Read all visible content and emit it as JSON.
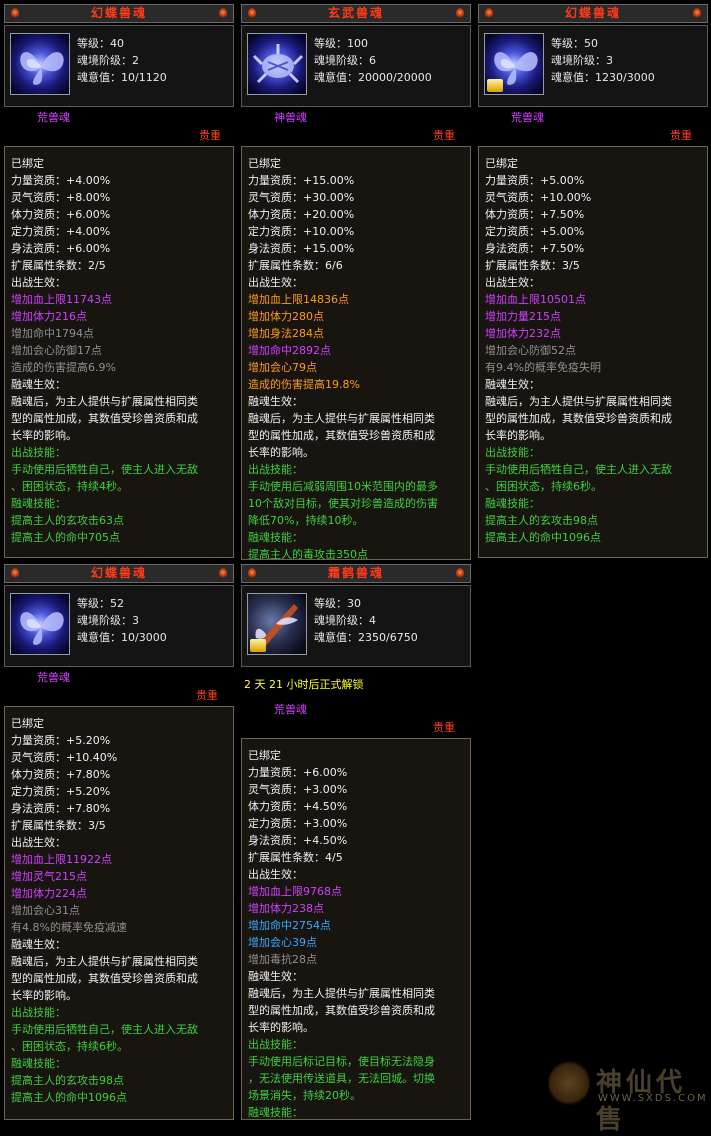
{
  "cards": [
    {
      "title": "幻蝶兽魂",
      "stats": [
        "等级：40",
        "魂境阶级：2",
        "魂意值：10/1120"
      ],
      "type": "荒兽魂",
      "rarity": "贵重",
      "lines": [
        {
          "t": "已绑定",
          "c": "w"
        },
        {
          "t": "力量资质：+4.00%",
          "c": "w"
        },
        {
          "t": "灵气资质：+8.00%",
          "c": "w"
        },
        {
          "t": "体力资质：+6.00%",
          "c": "w"
        },
        {
          "t": "定力资质：+4.00%",
          "c": "w"
        },
        {
          "t": "身法资质：+6.00%",
          "c": "w"
        },
        {
          "t": "扩展属性条数：2/5",
          "c": "w"
        },
        {
          "t": "出战生效：",
          "c": "w"
        },
        {
          "t": "增加血上限11743点",
          "c": "p"
        },
        {
          "t": "增加体力216点",
          "c": "p"
        },
        {
          "t": "增加命中1794点",
          "c": "g"
        },
        {
          "t": "增加会心防御17点",
          "c": "g"
        },
        {
          "t": "造成的伤害提高6.9%",
          "c": "g"
        },
        {
          "t": "融魂生效：",
          "c": "w"
        },
        {
          "t": "融魂后，为主人提供与扩展属性相同类",
          "c": "w"
        },
        {
          "t": "型的属性加成，其数值受珍兽资质和成",
          "c": "w"
        },
        {
          "t": "长率的影响。",
          "c": "w"
        },
        {
          "t": "出战技能：",
          "c": "gr"
        },
        {
          "t": "手动使用后牺牲自己，使主人进入无敌",
          "c": "gr"
        },
        {
          "t": "、困困状态，持续4秒。",
          "c": "gr"
        },
        {
          "t": "融魂技能：",
          "c": "gr"
        },
        {
          "t": "提高主人的玄攻击63点",
          "c": "gr"
        },
        {
          "t": "提高主人的命中705点",
          "c": "gr"
        }
      ]
    },
    {
      "title": "玄武兽魂",
      "stats": [
        "等级：100",
        "魂境阶级：6",
        "魂意值：20000/20000"
      ],
      "type": "神兽魂",
      "rarity": "贵重",
      "lines": [
        {
          "t": "已绑定",
          "c": "w"
        },
        {
          "t": "力量资质：+15.00%",
          "c": "w"
        },
        {
          "t": "灵气资质：+30.00%",
          "c": "w"
        },
        {
          "t": "体力资质：+20.00%",
          "c": "w"
        },
        {
          "t": "定力资质：+10.00%",
          "c": "w"
        },
        {
          "t": "身法资质：+15.00%",
          "c": "w"
        },
        {
          "t": "扩展属性条数：6/6",
          "c": "w"
        },
        {
          "t": "出战生效：",
          "c": "w"
        },
        {
          "t": "增加血上限14836点",
          "c": "o"
        },
        {
          "t": "增加体力280点",
          "c": "o"
        },
        {
          "t": "增加身法284点",
          "c": "o"
        },
        {
          "t": "增加命中2892点",
          "c": "p"
        },
        {
          "t": "增加会心79点",
          "c": "o"
        },
        {
          "t": "造成的伤害提高19.8%",
          "c": "o"
        },
        {
          "t": "融魂生效：",
          "c": "w"
        },
        {
          "t": "融魂后，为主人提供与扩展属性相同类",
          "c": "w"
        },
        {
          "t": "型的属性加成，其数值受珍兽资质和成",
          "c": "w"
        },
        {
          "t": "长率的影响。",
          "c": "w"
        },
        {
          "t": "出战技能：",
          "c": "gr"
        },
        {
          "t": "手动使用后减弱周围10米范围内的最多",
          "c": "gr"
        },
        {
          "t": "10个敌对目标，使其对珍兽造成的伤害",
          "c": "gr"
        },
        {
          "t": "降低70%，持续10秒。",
          "c": "gr"
        },
        {
          "t": "融魂技能：",
          "c": "gr"
        },
        {
          "t": "提高主人的毒攻击350点",
          "c": "gr"
        }
      ]
    },
    {
      "title": "幻蝶兽魂",
      "stats": [
        "等级：50",
        "魂境阶级：3",
        "魂意值：1230/3000"
      ],
      "type": "荒兽魂",
      "rarity": "贵重",
      "lines": [
        {
          "t": "已绑定",
          "c": "w"
        },
        {
          "t": "力量资质：+5.00%",
          "c": "w"
        },
        {
          "t": "灵气资质：+10.00%",
          "c": "w"
        },
        {
          "t": "体力资质：+7.50%",
          "c": "w"
        },
        {
          "t": "定力资质：+5.00%",
          "c": "w"
        },
        {
          "t": "身法资质：+7.50%",
          "c": "w"
        },
        {
          "t": "扩展属性条数：3/5",
          "c": "w"
        },
        {
          "t": "出战生效：",
          "c": "w"
        },
        {
          "t": "增加血上限10501点",
          "c": "p"
        },
        {
          "t": "增加力量215点",
          "c": "p"
        },
        {
          "t": "增加体力232点",
          "c": "p"
        },
        {
          "t": "增加会心防御52点",
          "c": "g"
        },
        {
          "t": "有9.4%的概率免疫失明",
          "c": "g"
        },
        {
          "t": "融魂生效：",
          "c": "w"
        },
        {
          "t": "融魂后，为主人提供与扩展属性相同类",
          "c": "w"
        },
        {
          "t": "型的属性加成，其数值受珍兽资质和成",
          "c": "w"
        },
        {
          "t": "长率的影响。",
          "c": "w"
        },
        {
          "t": "出战技能：",
          "c": "gr"
        },
        {
          "t": "手动使用后牺牲自己，使主人进入无敌",
          "c": "gr"
        },
        {
          "t": "、困困状态，持续6秒。",
          "c": "gr"
        },
        {
          "t": "融魂技能：",
          "c": "gr"
        },
        {
          "t": "提高主人的玄攻击98点",
          "c": "gr"
        },
        {
          "t": "提高主人的命中1096点",
          "c": "gr"
        }
      ]
    },
    {
      "title": "幻蝶兽魂",
      "stats": [
        "等级：52",
        "魂境阶级：3",
        "魂意值：10/3000"
      ],
      "type": "荒兽魂",
      "rarity": "贵重",
      "lines": [
        {
          "t": "已绑定",
          "c": "w"
        },
        {
          "t": "力量资质：+5.20%",
          "c": "w"
        },
        {
          "t": "灵气资质：+10.40%",
          "c": "w"
        },
        {
          "t": "体力资质：+7.80%",
          "c": "w"
        },
        {
          "t": "定力资质：+5.20%",
          "c": "w"
        },
        {
          "t": "身法资质：+7.80%",
          "c": "w"
        },
        {
          "t": "扩展属性条数：3/5",
          "c": "w"
        },
        {
          "t": "出战生效：",
          "c": "w"
        },
        {
          "t": "增加血上限11922点",
          "c": "p"
        },
        {
          "t": "增加灵气215点",
          "c": "p"
        },
        {
          "t": "增加体力224点",
          "c": "p"
        },
        {
          "t": "增加会心31点",
          "c": "g"
        },
        {
          "t": "有4.8%的概率免疫减速",
          "c": "g"
        },
        {
          "t": "融魂生效：",
          "c": "w"
        },
        {
          "t": "融魂后，为主人提供与扩展属性相同类",
          "c": "w"
        },
        {
          "t": "型的属性加成，其数值受珍兽资质和成",
          "c": "w"
        },
        {
          "t": "长率的影响。",
          "c": "w"
        },
        {
          "t": "出战技能：",
          "c": "gr"
        },
        {
          "t": "手动使用后牺牲自己，使主人进入无敌",
          "c": "gr"
        },
        {
          "t": "、困困状态，持续6秒。",
          "c": "gr"
        },
        {
          "t": "融魂技能：",
          "c": "gr"
        },
        {
          "t": "提高主人的玄攻击98点",
          "c": "gr"
        },
        {
          "t": "提高主人的命中1096点",
          "c": "gr"
        }
      ]
    },
    {
      "title": "霜鹤兽魂",
      "stats": [
        "等级：30",
        "魂境阶级：4",
        "魂意值：2350/6750"
      ],
      "unlock": "2 天 21 小时后正式解锁",
      "type": "荒兽魂",
      "rarity": "贵重",
      "lines": [
        {
          "t": "已绑定",
          "c": "w"
        },
        {
          "t": "力量资质：+6.00%",
          "c": "w"
        },
        {
          "t": "灵气资质：+3.00%",
          "c": "w"
        },
        {
          "t": "体力资质：+4.50%",
          "c": "w"
        },
        {
          "t": "定力资质：+3.00%",
          "c": "w"
        },
        {
          "t": "身法资质：+4.50%",
          "c": "w"
        },
        {
          "t": "扩展属性条数：4/5",
          "c": "w"
        },
        {
          "t": "出战生效：",
          "c": "w"
        },
        {
          "t": "增加血上限9768点",
          "c": "p"
        },
        {
          "t": "增加体力238点",
          "c": "p"
        },
        {
          "t": "增加命中2754点",
          "c": "b"
        },
        {
          "t": "增加会心39点",
          "c": "b"
        },
        {
          "t": "增加毒抗28点",
          "c": "g"
        },
        {
          "t": "融魂生效：",
          "c": "w"
        },
        {
          "t": "融魂后，为主人提供与扩展属性相同类",
          "c": "w"
        },
        {
          "t": "型的属性加成，其数值受珍兽资质和成",
          "c": "w"
        },
        {
          "t": "长率的影响。",
          "c": "w"
        },
        {
          "t": "出战技能：",
          "c": "gr"
        },
        {
          "t": "手动使用后标记目标，使目标无法隐身",
          "c": "gr"
        },
        {
          "t": "，无法使用传送道具，无法回城。切换",
          "c": "gr"
        },
        {
          "t": "场景消失，持续20秒。",
          "c": "gr"
        },
        {
          "t": "融魂技能：",
          "c": "gr"
        }
      ]
    }
  ],
  "watermark": {
    "brand": "神仙代售",
    "url": "WWW.SXDS.COM"
  }
}
